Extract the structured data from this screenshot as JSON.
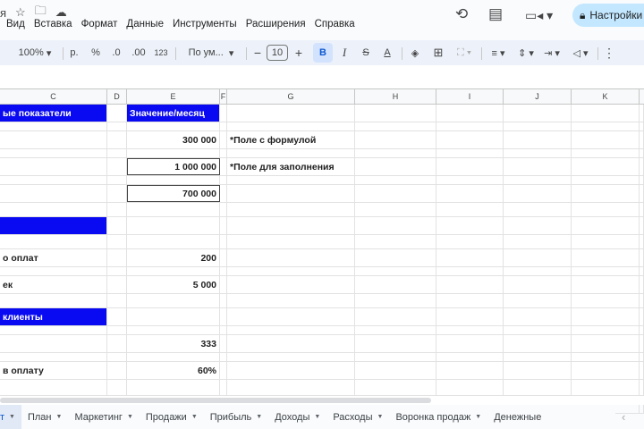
{
  "title_bar": {
    "title_fragment": "я",
    "icons": [
      "star-icon",
      "move-to-folder-icon",
      "cloud-status-icon"
    ]
  },
  "menu": [
    "Вид",
    "Вставка",
    "Формат",
    "Данные",
    "Инструменты",
    "Расширения",
    "Справка"
  ],
  "top_right": {
    "share_label": "Настройки",
    "icons": [
      "history-icon",
      "comments-icon",
      "meet-icon",
      "lock-icon"
    ]
  },
  "toolbar": {
    "zoom": "100%",
    "currency": "р.",
    "percent": "%",
    "dec_decrease": ".0",
    "dec_increase": ".00",
    "more_formats": "123",
    "font": "По ум...",
    "minus": "−",
    "font_size": "10",
    "plus": "+",
    "bold": "B",
    "italic": "I",
    "strike": "S",
    "text_color": "A",
    "more": "⋮"
  },
  "columns": [
    "C",
    "D",
    "E",
    "F",
    "G",
    "H",
    "I",
    "J",
    "K"
  ],
  "rows": [
    {
      "type": "blue",
      "c": "ые показатели",
      "e": "Значение/месяц",
      "e_blue": true
    },
    {
      "type": "spacer"
    },
    {
      "type": "data",
      "c": "",
      "e": "300 000",
      "g": "*Поле с формулой"
    },
    {
      "type": "spacer"
    },
    {
      "type": "data",
      "c": "",
      "e": "1 000 000",
      "g": "*Поле для заполнения",
      "boxed": true
    },
    {
      "type": "spacer"
    },
    {
      "type": "data",
      "c": "",
      "e": "700 000",
      "boxed": true
    },
    {
      "type": "spacer2"
    },
    {
      "type": "blue",
      "c": ""
    },
    {
      "type": "spacer2"
    },
    {
      "type": "data",
      "c": "о оплат",
      "e": "200"
    },
    {
      "type": "spacer"
    },
    {
      "type": "data",
      "c": "ек",
      "e": "5 000"
    },
    {
      "type": "spacer2"
    },
    {
      "type": "blue",
      "c": "клиенты"
    },
    {
      "type": "spacer"
    },
    {
      "type": "data",
      "c": "",
      "e": "333"
    },
    {
      "type": "spacer"
    },
    {
      "type": "data",
      "c": " в оплату",
      "e": "60%"
    },
    {
      "type": "spacer3"
    },
    {
      "type": "blue",
      "c": ""
    }
  ],
  "tabs": [
    {
      "label": "т",
      "active": true
    },
    {
      "label": "План"
    },
    {
      "label": "Маркетинг"
    },
    {
      "label": "Продажи"
    },
    {
      "label": "Прибыль"
    },
    {
      "label": "Доходы"
    },
    {
      "label": "Расходы"
    },
    {
      "label": "Воронка продаж"
    },
    {
      "label": "Денежные"
    }
  ],
  "colors": {
    "header_blue": "#0a0af2",
    "accent": "#0b57d0",
    "share_bg": "#c2e7ff"
  }
}
